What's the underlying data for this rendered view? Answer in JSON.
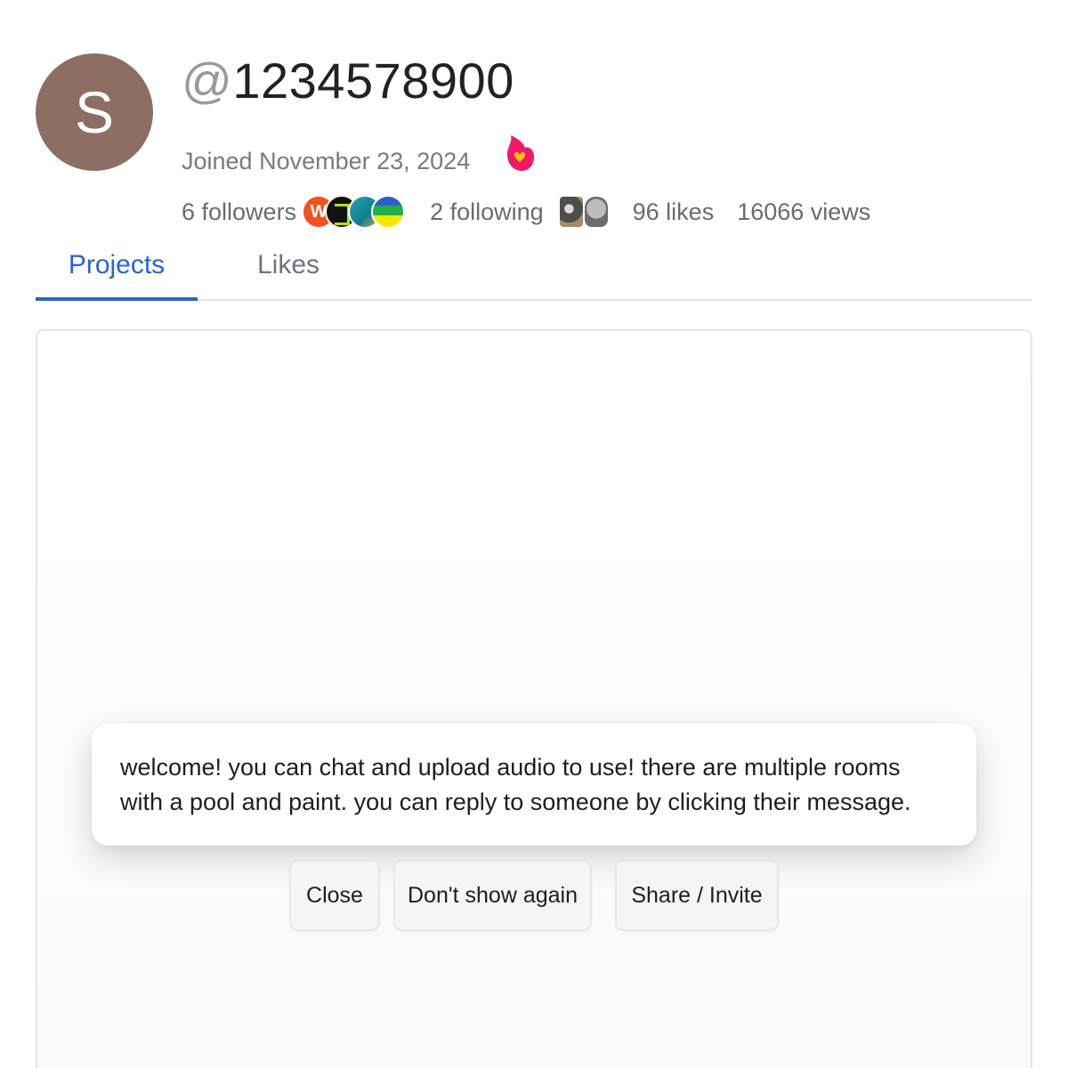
{
  "profile": {
    "avatar_letter": "S",
    "avatar_color": "#8d6e63",
    "username_prefix": "@",
    "username": "1234578900",
    "joined": "Joined November 23, 2024",
    "badge_icon": "flame-heart-icon"
  },
  "stats": {
    "followers": "6 followers",
    "follower_avatar_letter": "W",
    "following": "2 following",
    "likes": "96 likes",
    "views": "16066 views"
  },
  "tabs": [
    {
      "label": "Projects",
      "active": true
    },
    {
      "label": "Likes",
      "active": false
    }
  ],
  "accent_color": "#2a63d6",
  "dialog": {
    "message": "welcome! you can chat and upload audio to use! there are multiple rooms with a pool and paint. you can reply to someone by clicking their message.",
    "buttons": {
      "close": "Close",
      "dont_show": "Don't show again",
      "share": "Share / Invite"
    }
  }
}
